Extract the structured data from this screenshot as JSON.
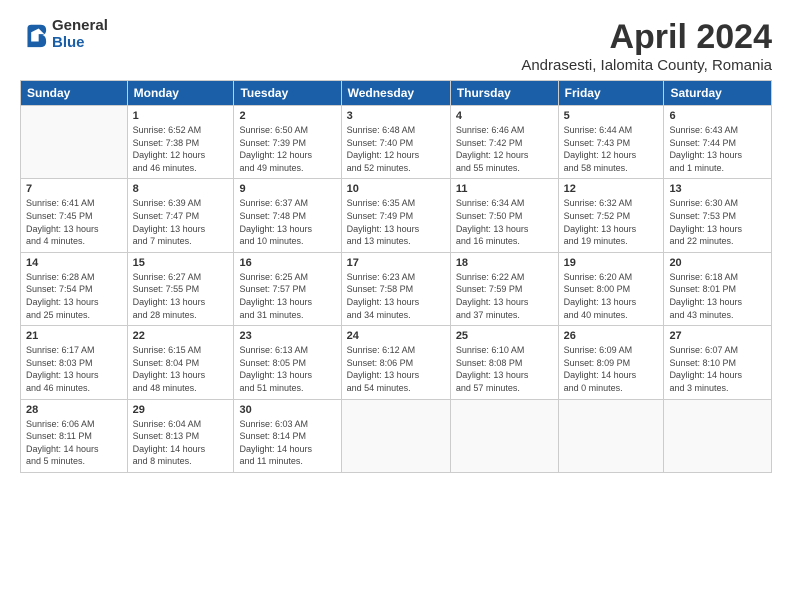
{
  "logo": {
    "general": "General",
    "blue": "Blue"
  },
  "title": "April 2024",
  "location": "Andrasesti, Ialomita County, Romania",
  "days_header": [
    "Sunday",
    "Monday",
    "Tuesday",
    "Wednesday",
    "Thursday",
    "Friday",
    "Saturday"
  ],
  "weeks": [
    [
      {
        "day": "",
        "info": ""
      },
      {
        "day": "1",
        "info": "Sunrise: 6:52 AM\nSunset: 7:38 PM\nDaylight: 12 hours\nand 46 minutes."
      },
      {
        "day": "2",
        "info": "Sunrise: 6:50 AM\nSunset: 7:39 PM\nDaylight: 12 hours\nand 49 minutes."
      },
      {
        "day": "3",
        "info": "Sunrise: 6:48 AM\nSunset: 7:40 PM\nDaylight: 12 hours\nand 52 minutes."
      },
      {
        "day": "4",
        "info": "Sunrise: 6:46 AM\nSunset: 7:42 PM\nDaylight: 12 hours\nand 55 minutes."
      },
      {
        "day": "5",
        "info": "Sunrise: 6:44 AM\nSunset: 7:43 PM\nDaylight: 12 hours\nand 58 minutes."
      },
      {
        "day": "6",
        "info": "Sunrise: 6:43 AM\nSunset: 7:44 PM\nDaylight: 13 hours\nand 1 minute."
      }
    ],
    [
      {
        "day": "7",
        "info": "Sunrise: 6:41 AM\nSunset: 7:45 PM\nDaylight: 13 hours\nand 4 minutes."
      },
      {
        "day": "8",
        "info": "Sunrise: 6:39 AM\nSunset: 7:47 PM\nDaylight: 13 hours\nand 7 minutes."
      },
      {
        "day": "9",
        "info": "Sunrise: 6:37 AM\nSunset: 7:48 PM\nDaylight: 13 hours\nand 10 minutes."
      },
      {
        "day": "10",
        "info": "Sunrise: 6:35 AM\nSunset: 7:49 PM\nDaylight: 13 hours\nand 13 minutes."
      },
      {
        "day": "11",
        "info": "Sunrise: 6:34 AM\nSunset: 7:50 PM\nDaylight: 13 hours\nand 16 minutes."
      },
      {
        "day": "12",
        "info": "Sunrise: 6:32 AM\nSunset: 7:52 PM\nDaylight: 13 hours\nand 19 minutes."
      },
      {
        "day": "13",
        "info": "Sunrise: 6:30 AM\nSunset: 7:53 PM\nDaylight: 13 hours\nand 22 minutes."
      }
    ],
    [
      {
        "day": "14",
        "info": "Sunrise: 6:28 AM\nSunset: 7:54 PM\nDaylight: 13 hours\nand 25 minutes."
      },
      {
        "day": "15",
        "info": "Sunrise: 6:27 AM\nSunset: 7:55 PM\nDaylight: 13 hours\nand 28 minutes."
      },
      {
        "day": "16",
        "info": "Sunrise: 6:25 AM\nSunset: 7:57 PM\nDaylight: 13 hours\nand 31 minutes."
      },
      {
        "day": "17",
        "info": "Sunrise: 6:23 AM\nSunset: 7:58 PM\nDaylight: 13 hours\nand 34 minutes."
      },
      {
        "day": "18",
        "info": "Sunrise: 6:22 AM\nSunset: 7:59 PM\nDaylight: 13 hours\nand 37 minutes."
      },
      {
        "day": "19",
        "info": "Sunrise: 6:20 AM\nSunset: 8:00 PM\nDaylight: 13 hours\nand 40 minutes."
      },
      {
        "day": "20",
        "info": "Sunrise: 6:18 AM\nSunset: 8:01 PM\nDaylight: 13 hours\nand 43 minutes."
      }
    ],
    [
      {
        "day": "21",
        "info": "Sunrise: 6:17 AM\nSunset: 8:03 PM\nDaylight: 13 hours\nand 46 minutes."
      },
      {
        "day": "22",
        "info": "Sunrise: 6:15 AM\nSunset: 8:04 PM\nDaylight: 13 hours\nand 48 minutes."
      },
      {
        "day": "23",
        "info": "Sunrise: 6:13 AM\nSunset: 8:05 PM\nDaylight: 13 hours\nand 51 minutes."
      },
      {
        "day": "24",
        "info": "Sunrise: 6:12 AM\nSunset: 8:06 PM\nDaylight: 13 hours\nand 54 minutes."
      },
      {
        "day": "25",
        "info": "Sunrise: 6:10 AM\nSunset: 8:08 PM\nDaylight: 13 hours\nand 57 minutes."
      },
      {
        "day": "26",
        "info": "Sunrise: 6:09 AM\nSunset: 8:09 PM\nDaylight: 14 hours\nand 0 minutes."
      },
      {
        "day": "27",
        "info": "Sunrise: 6:07 AM\nSunset: 8:10 PM\nDaylight: 14 hours\nand 3 minutes."
      }
    ],
    [
      {
        "day": "28",
        "info": "Sunrise: 6:06 AM\nSunset: 8:11 PM\nDaylight: 14 hours\nand 5 minutes."
      },
      {
        "day": "29",
        "info": "Sunrise: 6:04 AM\nSunset: 8:13 PM\nDaylight: 14 hours\nand 8 minutes."
      },
      {
        "day": "30",
        "info": "Sunrise: 6:03 AM\nSunset: 8:14 PM\nDaylight: 14 hours\nand 11 minutes."
      },
      {
        "day": "",
        "info": ""
      },
      {
        "day": "",
        "info": ""
      },
      {
        "day": "",
        "info": ""
      },
      {
        "day": "",
        "info": ""
      }
    ]
  ]
}
